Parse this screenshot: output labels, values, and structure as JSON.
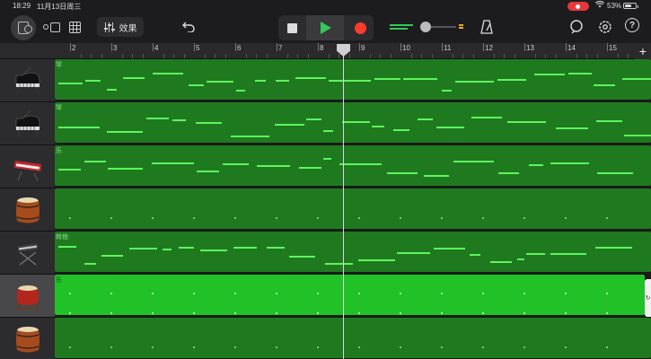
{
  "status_bar": {
    "time": "18:29",
    "date": "11月13日周三",
    "battery_percent": "53%",
    "battery_level": 0.53,
    "wifi_icon": "wifi-icon",
    "recording_indicator": "screen-recording-pill"
  },
  "toolbar": {
    "fx_label": "效果",
    "icons": [
      "browser-icon",
      "tracks-view-icon",
      "grid-icon",
      "mixer-icon",
      "undo-icon",
      "stop-icon",
      "play-icon",
      "record-icon",
      "volume-slider",
      "metronome-icon",
      "loop-icon",
      "settings-icon",
      "help-icon"
    ],
    "help_label": "?",
    "accent_play": "#34c759",
    "accent_record": "#ff3b30"
  },
  "ruler": {
    "bars": [
      "2",
      "3",
      "4",
      "5",
      "6",
      "7",
      "8",
      "9",
      "10",
      "11",
      "12",
      "13",
      "14",
      "15"
    ],
    "add_label": "+"
  },
  "tracks": [
    {
      "instrument": "grand-piano",
      "region_label": "琴"
    },
    {
      "instrument": "grand-piano",
      "region_label": "琴"
    },
    {
      "instrument": "synth-keyboard",
      "region_label": "乐"
    },
    {
      "instrument": "taiko-drum",
      "region_label": ""
    },
    {
      "instrument": "keyboard-stand",
      "region_label": "转他"
    },
    {
      "instrument": "taiko-drum-red",
      "region_label": "乐",
      "selected": true
    },
    {
      "instrument": "taiko-drum",
      "region_label": ""
    }
  ],
  "colors": {
    "region": "#1f7a1f",
    "region_selected": "#21c227",
    "note": "#5df55d",
    "background": "#1c1c1e"
  }
}
